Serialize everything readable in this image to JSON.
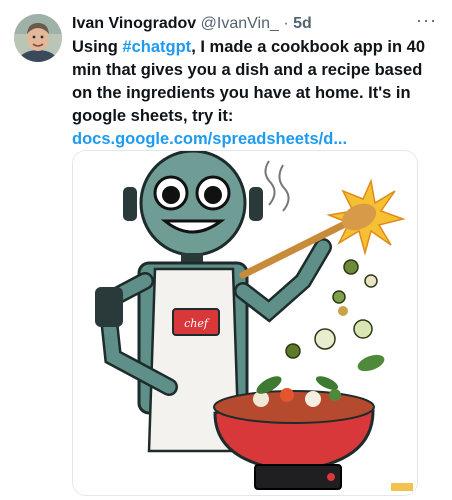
{
  "tweet": {
    "author_name": "Ivan Vinogradov",
    "handle": "@IvanVin_",
    "separator": "·",
    "time": "5d",
    "more_label": "···",
    "text_part1": "Using ",
    "hashtag": "#chatgpt",
    "text_part2": ", I made a cookbook app in 40 min that gives you a dish and a recipe based on the ingredients you have at home. It's in google sheets, try it:",
    "link": "docs.google.com/spreadsheets/d..."
  },
  "media": {
    "description_icon": "robot-chef-cooking-illustration",
    "apron_text": "chef"
  },
  "icons": {
    "avatar": "avatar-photo",
    "more": "more-icon"
  }
}
